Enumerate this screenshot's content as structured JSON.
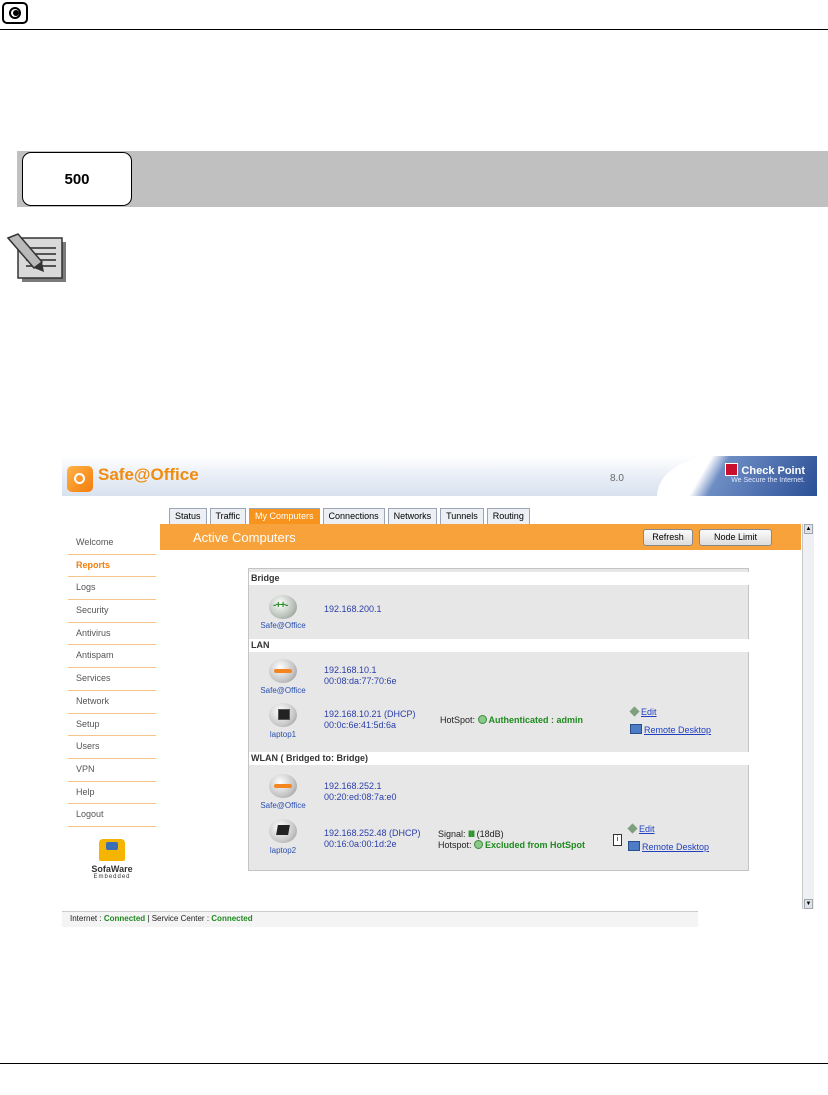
{
  "doc": {
    "box_number": "500"
  },
  "app": {
    "title": "Safe@Office",
    "version": "8.0",
    "brand": "Check Point",
    "brand_tagline": "We Secure the Internet.",
    "accent_color": "#f7941d"
  },
  "tabs": [
    {
      "label": "Status",
      "active": false
    },
    {
      "label": "Traffic",
      "active": false
    },
    {
      "label": "My Computers",
      "active": true
    },
    {
      "label": "Connections",
      "active": false
    },
    {
      "label": "Networks",
      "active": false
    },
    {
      "label": "Tunnels",
      "active": false
    },
    {
      "label": "Routing",
      "active": false
    }
  ],
  "sidebar": {
    "items": [
      {
        "label": "Welcome",
        "active": false
      },
      {
        "label": "Reports",
        "active": true
      },
      {
        "label": "Logs",
        "active": false
      },
      {
        "label": "Security",
        "active": false
      },
      {
        "label": "Antivirus",
        "active": false
      },
      {
        "label": "Antispam",
        "active": false
      },
      {
        "label": "Services",
        "active": false
      },
      {
        "label": "Network",
        "active": false
      },
      {
        "label": "Setup",
        "active": false
      },
      {
        "label": "Users",
        "active": false
      },
      {
        "label": "VPN",
        "active": false
      },
      {
        "label": "Help",
        "active": false
      },
      {
        "label": "Logout",
        "active": false
      }
    ],
    "footer_brand": "SofaWare",
    "footer_sub": "Embedded"
  },
  "page": {
    "heading": "Active Computers",
    "refresh_label": "Refresh",
    "node_limit_label": "Node Limit"
  },
  "sections": {
    "bridge": {
      "title": "Bridge",
      "device": {
        "name": "Safe@Office",
        "ip": "192.168.200.1"
      }
    },
    "lan": {
      "title": "LAN",
      "router": {
        "name": "Safe@Office",
        "ip": "192.168.10.1",
        "mac": "00:08:da:77:70:6e"
      },
      "client": {
        "name": "laptop1",
        "ip": "192.168.10.21 (DHCP)",
        "mac": "00:0c:6e:41:5d:6a",
        "hotspot_label": "HotSpot:",
        "hotspot_status": "Authenticated : admin",
        "edit_label": "Edit",
        "remote_label": "Remote Desktop"
      }
    },
    "wlan": {
      "title": "WLAN ( Bridged to: Bridge)",
      "router": {
        "name": "Safe@Office",
        "ip": "192.168.252.1",
        "mac": "00:20:ed:08:7a:e0"
      },
      "client": {
        "name": "laptop2",
        "ip": "192.168.252.48 (DHCP)",
        "mac": "00:16:0a:00:1d:2e",
        "signal_label": "Signal:",
        "signal_bars": "IIII",
        "signal_value": "(18dB)",
        "hotspot_label": "Hotspot:",
        "hotspot_status": "Excluded from HotSpot",
        "edit_label": "Edit",
        "remote_label": "Remote Desktop"
      }
    }
  },
  "status_bar": {
    "internet_label": "Internet :",
    "internet_value": "Connected",
    "service_label": "Service Center :",
    "service_value": "Connected"
  }
}
